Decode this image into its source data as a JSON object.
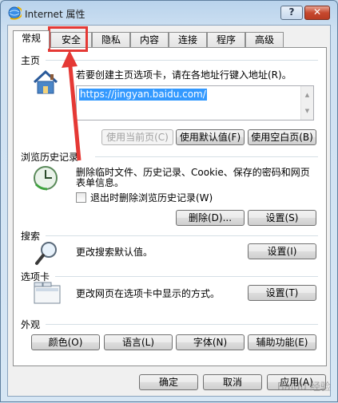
{
  "window": {
    "title": "Internet 属性",
    "help_label": "?",
    "close_label": "✕"
  },
  "tabs": [
    {
      "label": "常规",
      "active": true
    },
    {
      "label": "安全",
      "active": false
    },
    {
      "label": "隐私",
      "active": false
    },
    {
      "label": "内容",
      "active": false
    },
    {
      "label": "连接",
      "active": false
    },
    {
      "label": "程序",
      "active": false
    },
    {
      "label": "高级",
      "active": false
    }
  ],
  "home": {
    "title": "主页",
    "desc": "若要创建主页选项卡，请在各地址行键入地址(R)。",
    "address": "https://jingyan.baidu.com/",
    "btn_current": "使用当前页(C)",
    "btn_default": "使用默认值(F)",
    "btn_blank": "使用空白页(B)"
  },
  "history": {
    "title": "浏览历史记录",
    "desc_line1": "删除临时文件、历史记录、Cookie、保存的密码和网页",
    "desc_line2": "表单信息。",
    "checkbox_label": "退出时删除浏览历史记录(W)",
    "btn_delete": "删除(D)...",
    "btn_settings": "设置(S)"
  },
  "search": {
    "title": "搜索",
    "desc": "更改搜索默认值。",
    "btn_settings": "设置(I)"
  },
  "tabs_section": {
    "title": "选项卡",
    "desc": "更改网页在选项卡中显示的方式。",
    "btn_settings": "设置(T)"
  },
  "appearance": {
    "title": "外观",
    "btn_colors": "颜色(O)",
    "btn_languages": "语言(L)",
    "btn_fonts": "字体(N)",
    "btn_accessibility": "辅助功能(E)"
  },
  "footer": {
    "ok": "确定",
    "cancel": "取消",
    "apply": "应用(A)"
  },
  "watermark": "Baidu 经验",
  "colors": {
    "annotation_red": "#e53935",
    "selection_blue": "#3399ff"
  }
}
